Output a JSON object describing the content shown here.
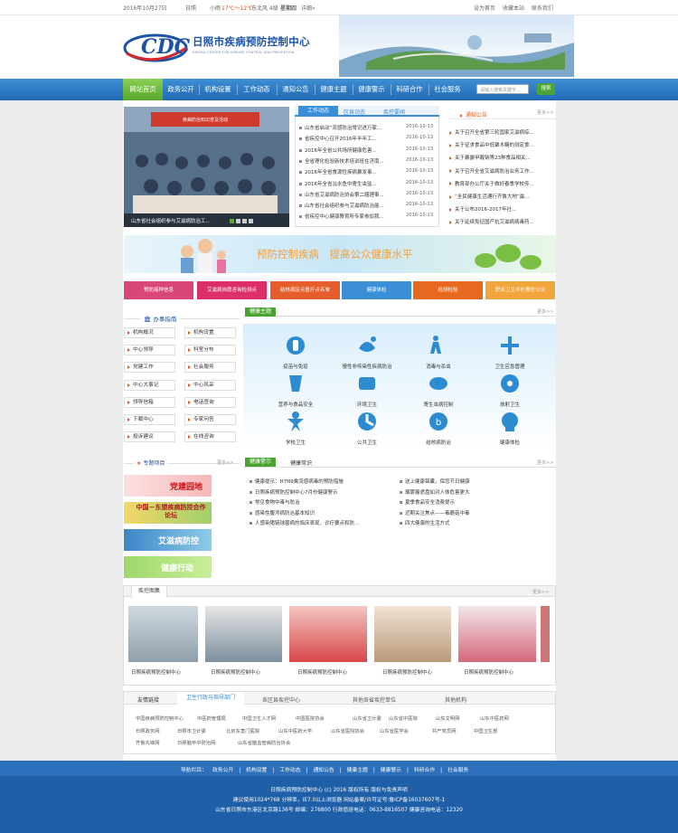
{
  "topbar": {
    "date": "2016年10月27日",
    "weekday": "星期四",
    "weather_city": "日照",
    "weather_desc": "小雨",
    "weather_temp": "17℃～12℃",
    "wind": "东北风 4级",
    "weekday2": "星期四",
    "detail": "详细»",
    "set_home": "设为首页",
    "favorite": "收藏本站",
    "contact": "联系我们"
  },
  "header": {
    "title": "日照市疾病预防控制中心",
    "subtitle": "RIZHAO CENTER FOR DISEASE CONTROL AND PREVENTION",
    "logo_text": "CDC"
  },
  "nav": {
    "items": [
      "网站首页",
      "政务公开",
      "机构设置",
      "工作动态",
      "通知公告",
      "健康主题",
      "健康警示",
      "科研合作",
      "社会服务"
    ],
    "search_placeholder": "请输入搜索关键字...",
    "search_button": "搜索"
  },
  "slideshow": {
    "caption": "山东省社会组织参与艾滋病防治工...",
    "banner_text": "疾病防治知识普及活动"
  },
  "news": {
    "tabs": [
      "工作动态",
      "区县动态",
      "疾控要闻"
    ],
    "items": [
      {
        "title": "山东省启动“流感防治常识进万家...",
        "date": "2016-10-13"
      },
      {
        "title": "省疾控中心召开2016年半年工...",
        "date": "2016-10-13"
      },
      {
        "title": "2016年全省公共场所健康危害...",
        "date": "2016-10-13"
      },
      {
        "title": "全省理化检验新技术培训班在济南...",
        "date": "2016-10-13"
      },
      {
        "title": "2016年全省食源性疾病暴发事...",
        "date": "2016-10-13"
      },
      {
        "title": "2016年全省淡水鱼中寄生虫监...",
        "date": "2016-10-13"
      },
      {
        "title": "山东省艾滋病防治协会第二届理事...",
        "date": "2016-10-13"
      },
      {
        "title": "山东省社会组织参与艾滋病防治能...",
        "date": "2016-10-13"
      },
      {
        "title": "省疾控中心健康教育所专家参加我...",
        "date": "2016-10-13"
      }
    ]
  },
  "notice": {
    "title": "通知公告",
    "more": "更多>>",
    "items": [
      "关于召开全省第三轮国家艾滋病综...",
      "关于征求食品中低聚木糖的测定食...",
      "关于暴露甲酸钠等23种食品相关...",
      "关于召开全省艾滋病防治业务工作...",
      "教育部办公厅关于做好春季学校传...",
      "“全民健康生活通行齐鲁大地”最...",
      "关于公布2016-2017年社...",
      "关于延续免征国产抗艾滋病病毒药..."
    ]
  },
  "banner": {
    "slogan": "预防控制疾病　提高公众健康水平"
  },
  "quick_links": [
    {
      "label": "预防接种信息",
      "color": "#d9477a"
    },
    {
      "label": "艾滋病自愿咨询检测点",
      "color": "#db2f69"
    },
    {
      "label": "结核病定点医疗点名单",
      "color": "#e45d2a"
    },
    {
      "label": "健康体检",
      "color": "#3a8fd6"
    },
    {
      "label": "检测检验",
      "color": "#e7681f"
    },
    {
      "label": "职业卫生评价报告公示",
      "color": "#f1a53a"
    }
  ],
  "guide": {
    "title": "办事指南",
    "items": [
      "机构概况",
      "机构设置",
      "中心领导",
      "科室分布",
      "党建工作",
      "社会服务",
      "中心大事记",
      "中心风采",
      "领导信箱",
      "电话查询",
      "下载中心",
      "专家问答",
      "投诉建议",
      "在线咨询"
    ]
  },
  "health_topics": {
    "title": "健康主题",
    "more": "更多>>",
    "items": [
      "疫苗与免疫",
      "慢性非传染性疾病防治",
      "消毒与杀虫",
      "卫生应急管理",
      "营养与食品安全",
      "环境卫生",
      "寄生虫病控制",
      "放射卫生",
      "学校卫生",
      "公共卫生",
      "结核病防治",
      "健康体检"
    ]
  },
  "projects": {
    "title": "专题项目",
    "more": "更多>>",
    "banners": [
      "党建园地",
      "中国－东盟疾病防控合作论坛",
      "艾滋病防控",
      "健康行动"
    ]
  },
  "warning": {
    "tabs": [
      "健康警示",
      "健康常识"
    ],
    "more": "更多>>",
    "left": [
      "健康提示：H7N9禽流感病毒的预防措施",
      "日照疾病预防控制中心7月份健康警示",
      "常见食物中毒与防治",
      "感染性腹泻病防治基本知识",
      "人感染猪链球菌病的临床表现、诊疗要点和防..."
    ],
    "right": [
      "送上健康锦囊，保您节日健康",
      "烟雾霾遮盘如对人体危害更大",
      "夏季食品安全消费提示",
      "近期关注焦点——毒蘑菇中毒",
      "四大健康的生活方式"
    ]
  },
  "gallery": {
    "title": "疾控图集",
    "more": "更多>>",
    "captions": [
      "日照疾病预防控制中心",
      "日照疾病预防控制中心",
      "日照疾病预防控制中心",
      "日照疾病预防控制中心",
      "日照疾病预防控制中心"
    ]
  },
  "links": {
    "label": "友情链接",
    "tabs": [
      "卫生行政与指导部门",
      "各区县疾控中心",
      "其他各省疾控单位",
      "其他机构"
    ],
    "rows": [
      [
        "中国疾病预防控制中心",
        "中医药管理局",
        "中国卫生人才网",
        "中国医院协会",
        "山东省卫计委",
        "山东省中医院",
        "山东文明网",
        "山东中医药网"
      ],
      [
        "日照政务网",
        "日照市卫计委",
        "北京东直门医院",
        "山东中医药大学",
        "山东省医院协会",
        "山东省医学会",
        "共产党员网",
        "中国卫生部"
      ],
      [
        "齐鲁先锋网",
        "日照脑卒中防治网",
        "山东省脑血管病防治协会"
      ]
    ]
  },
  "footer": {
    "nav_label": "导航栏目：",
    "nav": [
      "政务公开",
      "机构设置",
      "工作动态",
      "通知公告",
      "健康主题",
      "健康警示",
      "科研合作",
      "社会服务"
    ],
    "line1": "日照疾病预防控制中心 (c) 2016 版权所有 版权与免责声明",
    "line2": "建议使用1024*768 分辨率，IE7.0以上浏览器  网站备案/许可证号:鲁ICP备16037607号-1",
    "line3": "山东省日照市东港区北京路136号 邮编：276800 行政值班电话：0633-8816507 健康咨询电话：12320"
  }
}
